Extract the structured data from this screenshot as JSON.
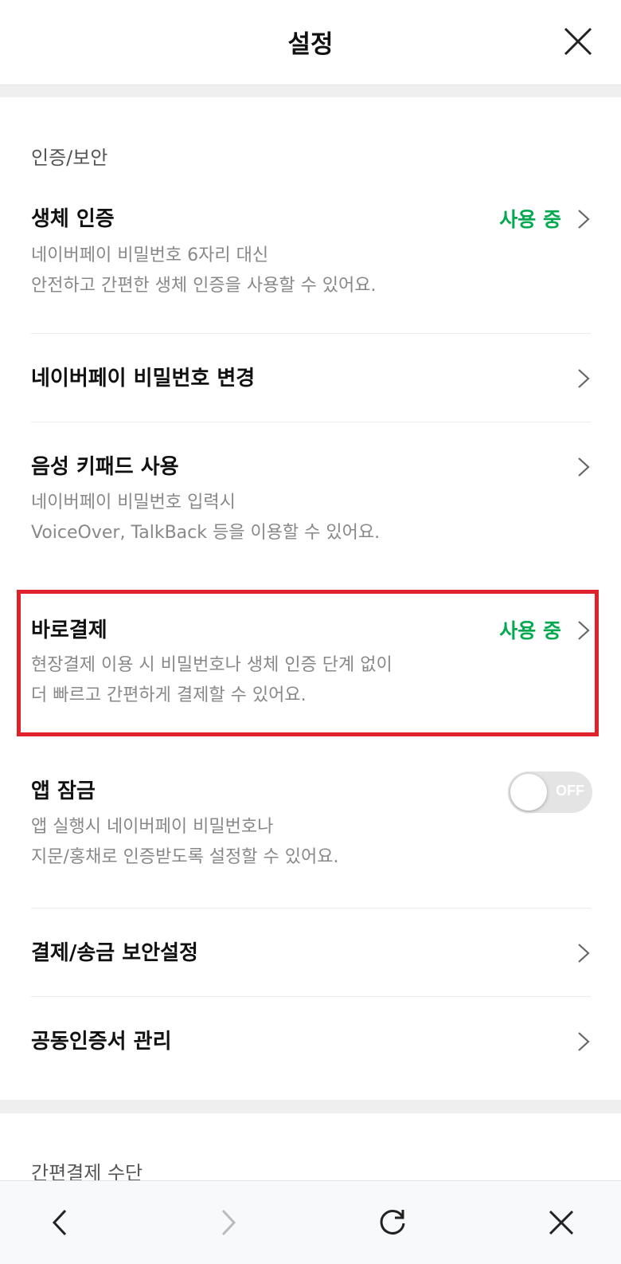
{
  "header": {
    "title": "설정",
    "close_icon": "close-icon"
  },
  "accent_color": "#03a94f",
  "section1": {
    "title": "인증/보안",
    "items": [
      {
        "label": "생체 인증",
        "status": "사용 중",
        "desc1": "네이버페이 비밀번호 6자리 대신",
        "desc2": "안전하고 간편한 생체 인증을 사용할 수 있어요."
      },
      {
        "label": "네이버페이 비밀번호 변경"
      },
      {
        "label": "음성 키패드 사용",
        "desc1": "네이버페이 비밀번호 입력시",
        "desc2": "VoiceOver, TalkBack 등을 이용할 수 있어요."
      },
      {
        "label": "바로결제",
        "status": "사용 중",
        "desc1": "현장결제 이용 시 비밀번호나 생체 인증 단계 없이",
        "desc2": "더 빠르고 간편하게 결제할 수 있어요."
      },
      {
        "label": "앱 잠금",
        "toggle_text": "OFF",
        "toggle_on": false,
        "desc1": "앱 실행시 네이버페이 비밀번호나",
        "desc2": "지문/홍채로 인증받도록 설정할 수 있어요."
      },
      {
        "label": "결제/송금 보안설정"
      },
      {
        "label": "공동인증서 관리"
      }
    ]
  },
  "section2": {
    "title": "간편결제 수단"
  },
  "highlight_color": "#e0202a",
  "bottom_bar": {
    "back_icon": "back-icon",
    "forward_icon": "forward-icon",
    "refresh_icon": "refresh-icon",
    "close_icon": "close-icon"
  }
}
